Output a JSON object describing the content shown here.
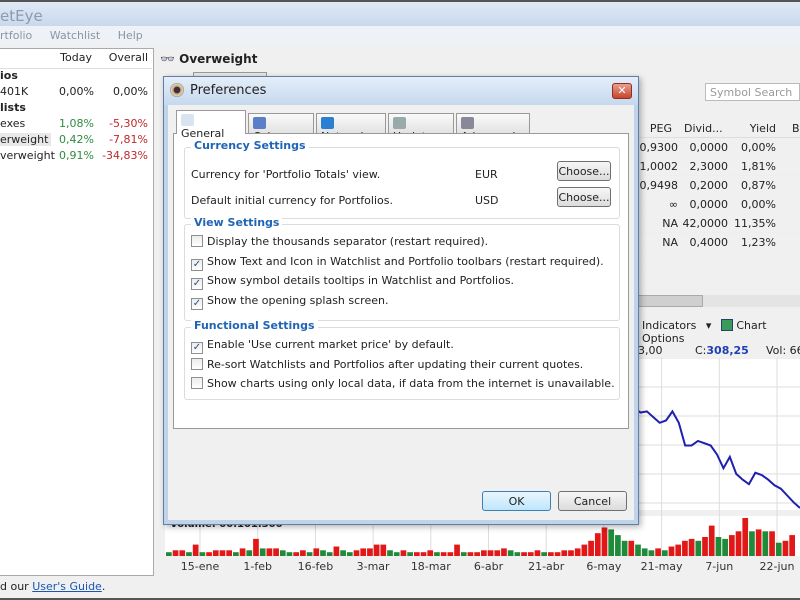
{
  "app": {
    "title": "etEye",
    "menu": [
      "rtfolio",
      "Watchlist",
      "Help"
    ]
  },
  "left": {
    "headers": {
      "today": "Today",
      "overall": "Overall"
    },
    "rows": [
      {
        "name": "ios",
        "bold": true,
        "today": "",
        "overall": ""
      },
      {
        "name": "401K",
        "today": "0,00%",
        "overall": "0,00%",
        "tc": "",
        "oc": ""
      },
      {
        "name": "lists",
        "bold": true,
        "today": "",
        "overall": ""
      },
      {
        "name": "exes",
        "today": "1,08%",
        "overall": "-5,30%",
        "tc": "g",
        "oc": "r"
      },
      {
        "name": "erweight",
        "today": "0,42%",
        "overall": "-7,81%",
        "tc": "g",
        "oc": "r",
        "selected": true
      },
      {
        "name": "verweight",
        "today": "0,91%",
        "overall": "-34,83%",
        "tc": "g",
        "oc": "r"
      }
    ]
  },
  "main": {
    "title": "Overweight",
    "search_placeholder": "Symbol Search",
    "columns": [
      "PEG",
      "Divid...",
      "Yield",
      "B"
    ],
    "rows": [
      [
        "0,9300",
        "0,0000",
        "0,00%"
      ],
      [
        "1,0002",
        "2,3000",
        "1,81%"
      ],
      [
        "0,9498",
        "0,2000",
        "0,87%"
      ],
      [
        "∞",
        "0,0000",
        "0,00%"
      ],
      [
        "NA",
        "42,0000",
        "11,35%"
      ],
      [
        "NA",
        "0,4000",
        "1,23%"
      ]
    ],
    "indicators": "Indicators",
    "chart_options": "Chart Options",
    "quote": {
      "prev": "3,00",
      "close_label": "C:",
      "close": "308,25",
      "vol": "Vol: 66"
    },
    "volume_label": "Volume: 00.101.300",
    "x_labels": [
      "15-ene",
      "1-feb",
      "16-feb",
      "3-mar",
      "18-mar",
      "6-abr",
      "21-abr",
      "6-may",
      "21-may",
      "7-jun",
      "22-jun"
    ]
  },
  "chart_data": {
    "type": "bar",
    "price_line_color": "#2020b0",
    "up_color": "#1e8a3a",
    "down_color": "#e01818",
    "price": [
      318,
      318.2,
      318,
      318.3,
      317.9,
      318,
      317.5,
      317,
      317.2,
      318,
      317,
      315,
      315,
      315.4,
      315.2,
      315,
      314.2,
      313,
      314,
      312.5,
      312,
      311.6,
      312.6,
      312.4,
      312,
      311.5,
      311.2,
      310.6,
      310,
      309.5
    ],
    "volume": [
      2,
      3,
      3,
      2,
      6,
      2,
      2,
      3,
      3,
      3,
      2,
      4,
      3,
      9,
      4,
      4,
      4,
      3,
      2,
      2,
      3,
      2,
      4,
      3,
      2,
      5,
      3,
      2,
      3,
      4,
      4,
      6,
      6,
      3,
      2,
      3,
      2,
      2,
      2,
      3,
      2,
      2,
      2,
      6,
      2,
      2,
      2,
      3,
      3,
      3,
      4,
      3,
      2,
      2,
      2,
      3,
      2,
      2,
      2,
      3,
      3,
      4,
      6,
      8,
      12,
      15,
      14,
      11,
      8,
      8,
      6,
      4,
      3,
      4,
      3,
      5,
      6,
      8,
      9,
      8,
      10,
      16,
      10,
      9,
      11,
      13,
      20,
      13,
      14,
      13,
      13,
      7,
      8,
      11
    ]
  },
  "status": {
    "prefix": "d our ",
    "link": "User's Guide",
    "suffix": "."
  },
  "dialog": {
    "title": "Preferences",
    "close": "✕",
    "tabs": [
      {
        "label": "General",
        "icon": "clipboard-icon",
        "color": "#d8e4f0"
      },
      {
        "label": "Columns",
        "icon": "columns-icon",
        "color": "#5a7fc8"
      },
      {
        "label": "Network",
        "icon": "globe-icon",
        "color": "#2a7fd0"
      },
      {
        "label": "Update",
        "icon": "gears-icon",
        "color": "#9aa"
      },
      {
        "label": "Advanced",
        "icon": "magnifier-gear-icon",
        "color": "#889"
      }
    ],
    "currency": {
      "title": "Currency Settings",
      "rows": [
        {
          "label": "Currency for 'Portfolio Totals' view.",
          "value": "EUR",
          "button": "Choose..."
        },
        {
          "label": "Default initial currency for Portfolios.",
          "value": "USD",
          "button": "Choose..."
        }
      ]
    },
    "view": {
      "title": "View Settings",
      "items": [
        {
          "label": "Display the thousands separator  (restart required).",
          "checked": false
        },
        {
          "label": "Show Text and Icon in Watchlist and Portfolio toolbars  (restart required).",
          "checked": true
        },
        {
          "label": "Show symbol details tooltips in Watchlist and Portfolios.",
          "checked": true
        },
        {
          "label": "Show the opening splash screen.",
          "checked": true
        }
      ]
    },
    "functional": {
      "title": "Functional Settings",
      "items": [
        {
          "label": "Enable 'Use current market price' by default.",
          "checked": true
        },
        {
          "label": "Re-sort Watchlists and Portfolios after updating their current quotes.",
          "checked": false
        },
        {
          "label": "Show charts using only local data, if data from the internet is unavailable.",
          "checked": false
        }
      ]
    },
    "ok": "OK",
    "cancel": "Cancel"
  }
}
